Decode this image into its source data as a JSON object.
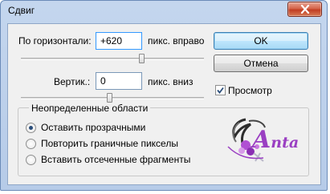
{
  "window": {
    "title": "Сдвиг"
  },
  "horizontal": {
    "label": "По горизонтали:",
    "value": "+620",
    "unit": "пикс. вправо",
    "slider_level": 0.62
  },
  "vertical": {
    "label": "Вертик.:",
    "value": "0",
    "unit": "пикс. вниз",
    "slider_level": 0.5
  },
  "buttons": {
    "ok": "OK",
    "cancel": "Отмена"
  },
  "preview": {
    "label": "Просмотр",
    "checked": true
  },
  "undefined_areas": {
    "legend": "Неопределенные области",
    "options": [
      {
        "label": "Оставить прозрачными",
        "selected": true
      },
      {
        "label": "Повторить граничные пикселы",
        "selected": false
      },
      {
        "label": "Вставить отсеченные фрагменты",
        "selected": false
      }
    ]
  },
  "signature": {
    "big": "A",
    "rest": "nta",
    "color": "#9a3fc2"
  },
  "icons": [
    "close-icon",
    "checkmark-icon",
    "signature-flower-icon"
  ]
}
